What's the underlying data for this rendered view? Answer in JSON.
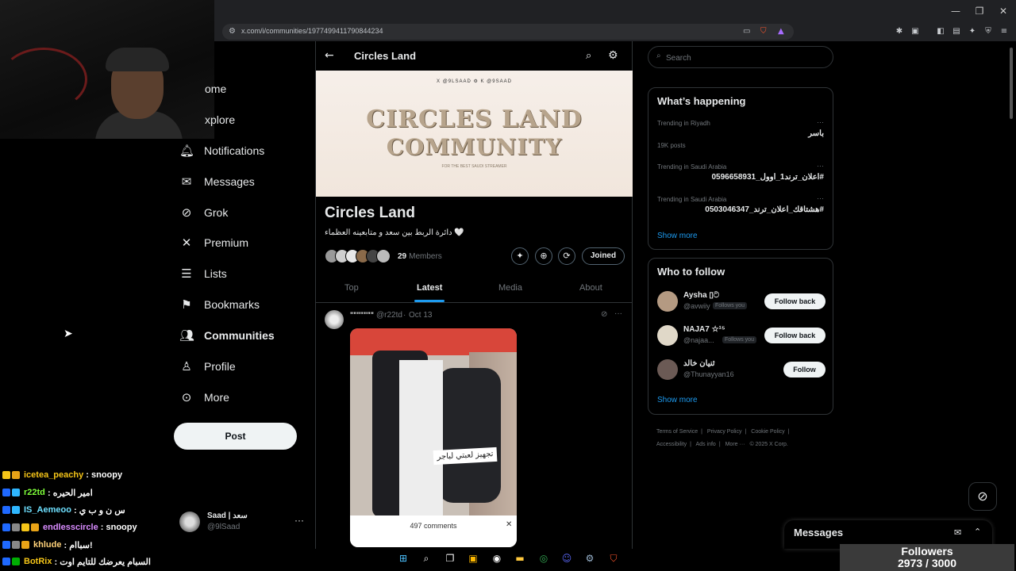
{
  "browser": {
    "url": "x.com/i/communities/1977499411790844234",
    "window_controls": [
      "—",
      "❐",
      "✕"
    ]
  },
  "nav": {
    "items": [
      {
        "icon": "home-icon",
        "label": "ome"
      },
      {
        "icon": "explore-icon",
        "label": "xplore"
      },
      {
        "icon": "bell-icon",
        "label": "Notifications"
      },
      {
        "icon": "mail-icon",
        "label": "Messages"
      },
      {
        "icon": "grok-icon",
        "label": "Grok"
      },
      {
        "icon": "x-logo-icon",
        "label": "Premium"
      },
      {
        "icon": "list-icon",
        "label": "Lists"
      },
      {
        "icon": "bookmark-icon",
        "label": "Bookmarks"
      },
      {
        "icon": "communities-icon",
        "label": "Communities"
      },
      {
        "icon": "profile-icon",
        "label": "Profile"
      },
      {
        "icon": "more-circle-icon",
        "label": "More"
      }
    ],
    "post_label": "Post",
    "account": {
      "name": "Saad | سعد",
      "handle": "@9lSaad",
      "more": "···"
    }
  },
  "chat": [
    {
      "user": "icetea_peachy",
      "user_color": "#f5c518",
      "msg": ": snoopy"
    },
    {
      "user": "r22td",
      "user_color": "#7fff3a",
      "msg": ": امير الحيره"
    },
    {
      "user": "IS_Aemeoo",
      "user_color": "#6ee0ff",
      "msg": ": س ن و ب ي"
    },
    {
      "user": "endlesscircle",
      "user_color": "#d98cff",
      "msg": ": snoopy"
    },
    {
      "user": "khlude",
      "user_color": "#ffd27a",
      "msg": ": سباام!"
    },
    {
      "user": "BotRix",
      "user_color": "#f5c518",
      "msg": ": السبام يعرضك للتايم اوت"
    }
  ],
  "community": {
    "header_title": "Circles Land",
    "banner_top": "X @9LSAAD    ⚙    K @9SAAD",
    "banner_line1": "CIRCLES LAND",
    "banner_line2": "COMMUNITY",
    "banner_sub": "FOR THE BEST SAUDI STREAMER",
    "name": "Circles Land",
    "description": "دائرة الربط بين سعد و متابعينه العظماء 🤍",
    "member_count": "29",
    "member_label": "Members",
    "joined_label": "Joined",
    "tabs": [
      "Top",
      "Latest",
      "Media",
      "About"
    ]
  },
  "post": {
    "name": "\"\"\"\"\"\"\"",
    "handle": "@r22td",
    "separator": "·",
    "date": "Oct 13",
    "media_caption": "تجهيز لعبتي لباجر",
    "comments_label": "497 comments"
  },
  "search": {
    "placeholder": "Search"
  },
  "trending": {
    "title": "What’s happening",
    "items": [
      {
        "category": "Trending in Riyadh",
        "name": "باسر",
        "count": "19K posts"
      },
      {
        "category": "Trending in Saudi Arabia",
        "name": "#اعلان_ترند1_اوول_0596658931",
        "count": ""
      },
      {
        "category": "Trending in Saudi Arabia",
        "name": "#هشتاقك_اعلان_ترند_0503046347",
        "count": ""
      }
    ],
    "more_dots": "···",
    "show_more": "Show more"
  },
  "who_to_follow": {
    "title": "Who to follow",
    "items": [
      {
        "name": "Aysha ▯ට",
        "handle": "@avwiiy",
        "follows_you": "Follows you",
        "button": "Follow back"
      },
      {
        "name": "NAJA7 ☆¹⁵",
        "handle": "@najaa...",
        "follows_you": "Follows you",
        "button": "Follow back"
      },
      {
        "name": "ثنيان خالد",
        "handle": "@Thunayyan16",
        "follows_you": "",
        "button": "Follow"
      }
    ],
    "show_more": "Show more"
  },
  "footer": {
    "links": [
      "Terms of Service",
      "|",
      "Privacy Policy",
      "|",
      "Cookie Policy",
      "|",
      "Accessibility",
      "|",
      "Ads info",
      "|",
      "More ···",
      "© 2025 X Corp."
    ]
  },
  "messages_drawer": {
    "title": "Messages"
  },
  "followers_widget": {
    "label": "Followers",
    "count": "2973 / 3000"
  },
  "colors": {
    "accent": "#1d9bf0",
    "background": "#000000",
    "border": "#2f3336"
  }
}
